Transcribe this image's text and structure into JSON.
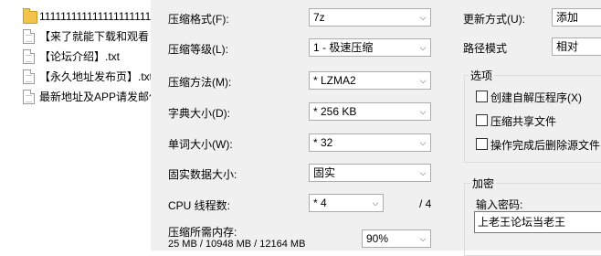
{
  "file_list": [
    {
      "type": "folder",
      "name": "111111111111111111111"
    },
    {
      "type": "doc",
      "name": "【来了就能下载和观看"
    },
    {
      "type": "doc",
      "name": "【论坛介绍】.txt"
    },
    {
      "type": "doc",
      "name": "【永久地址发布页】.txt"
    },
    {
      "type": "doc",
      "name": "最新地址及APP请发邮件"
    }
  ],
  "dialog": {
    "format": {
      "label": "压缩格式(F):",
      "value": "7z"
    },
    "level": {
      "label": "压缩等级(L):",
      "value": "1 - 极速压缩"
    },
    "method": {
      "label": "压缩方法(M):",
      "value": "* LZMA2"
    },
    "dict": {
      "label": "字典大小(D):",
      "value": "* 256 KB"
    },
    "word": {
      "label": "单词大小(W):",
      "value": "* 32"
    },
    "solid": {
      "label": "固实数据大小:",
      "value": "固实"
    },
    "threads": {
      "label": "CPU 线程数:",
      "value": "* 4",
      "max": "/ 4"
    },
    "memory": {
      "label": "压缩所需内存:",
      "detail": "25 MB / 10948 MB / 12164 MB",
      "percent": "90%"
    },
    "update": {
      "label": "更新方式(U):",
      "value": "添加"
    },
    "path": {
      "label": "路径模式",
      "value": "相对"
    },
    "options": {
      "title": "选项",
      "items": [
        "创建自解压程序(X)",
        "压缩共享文件",
        "操作完成后删除源文件"
      ]
    },
    "encryption": {
      "title": "加密",
      "password_label": "输入密码:",
      "password_value": "上老王论坛当老王"
    }
  }
}
